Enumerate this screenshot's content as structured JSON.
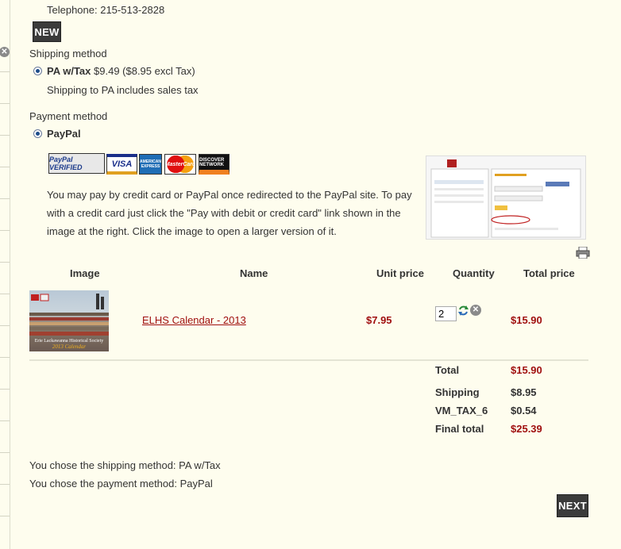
{
  "address": {
    "telephone": "Telephone: 215-513-2828"
  },
  "buttons": {
    "new_label": "NEW",
    "next_label": "NEXT"
  },
  "shipping": {
    "heading": "Shipping method",
    "option_name": "PA w/Tax",
    "option_price": "$9.49 ($8.95 excl Tax)",
    "note": "Shipping to PA includes sales tax"
  },
  "payment": {
    "heading": "Payment method",
    "option_name": "PayPal",
    "cards": [
      "PayPal VERIFIED",
      "VISA",
      "AMERICAN EXPRESS",
      "MasterCard",
      "DISCOVER NETWORK"
    ],
    "description": "You may pay by credit card or PayPal once redirected to the PayPal site.  To pay with a credit card just click the \"Pay with debit or credit card\" link shown in the image at the right.  Click the image to open a larger version of it."
  },
  "cart": {
    "headers": {
      "image": "Image",
      "name": "Name",
      "unit_price": "Unit price",
      "quantity": "Quantity",
      "total_price": "Total price"
    },
    "item": {
      "name": "ELHS Calendar - 2013",
      "unit_price": "$7.95",
      "quantity": "2",
      "total_price": "$15.90",
      "thumb_caption_1": "Erie Lackawanna Historical Society",
      "thumb_caption_2": "2013 Calendar"
    },
    "summary": {
      "total_label": "Total",
      "total_value": "$15.90",
      "shipping_label": "Shipping",
      "shipping_value": "$8.95",
      "tax_label": "VM_TAX_6",
      "tax_value": "$0.54",
      "final_label": "Final total",
      "final_value": "$25.39"
    }
  },
  "confirm": {
    "shipping_line": "You chose the shipping method: PA w/Tax",
    "payment_line": "You chose the payment method: PayPal"
  },
  "colors": {
    "background": "#fefdee",
    "price_red": "#a01010",
    "button_dark": "#3b3b3b",
    "radio_blue": "#1d4d8a"
  }
}
